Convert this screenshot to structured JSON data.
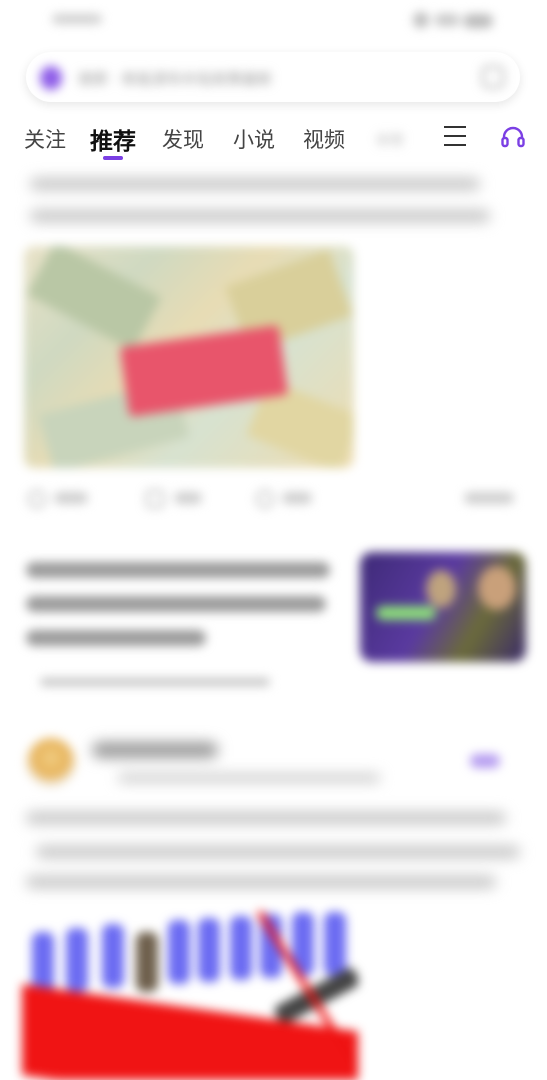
{
  "search": {
    "placeholder": "搜索 · 新能源车补贴政策最新"
  },
  "tabs": [
    {
      "label": "关注"
    },
    {
      "label": "推荐"
    },
    {
      "label": "发现"
    },
    {
      "label": "小说"
    },
    {
      "label": "视频"
    },
    {
      "label": "体育"
    }
  ],
  "icons": {
    "search": "search-icon",
    "scan": "scan-icon",
    "menu": "menu-icon",
    "headphones": "headphones-icon"
  },
  "colors": {
    "accent": "#7b3fe4",
    "search_icon": "#8e5de8"
  }
}
